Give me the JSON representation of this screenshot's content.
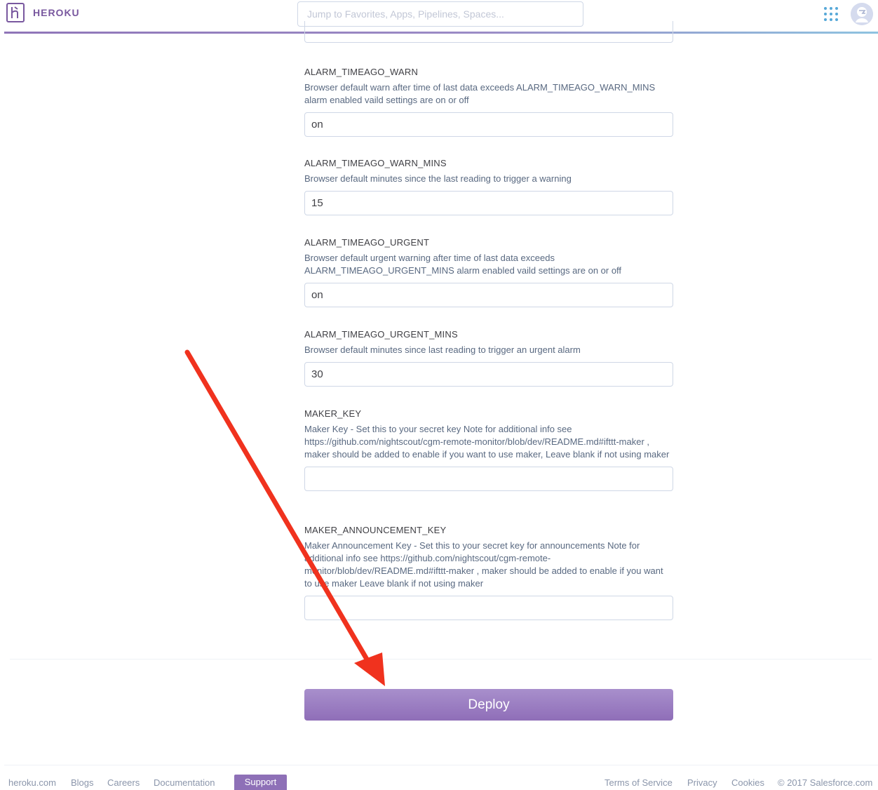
{
  "header": {
    "brand": "HEROKU",
    "search_placeholder": "Jump to Favorites, Apps, Pipelines, Spaces...",
    "apps_icon": "grid-dots-icon",
    "avatar_icon": "user-avatar-icon",
    "accent_color": "#79589f"
  },
  "fields": [
    {
      "key": "ALARM_TIMEAGO_WARN",
      "description": "Browser default warn after time of last data exceeds ALARM_TIMEAGO_WARN_MINS alarm enabled vaild settings are on or off",
      "value": "on"
    },
    {
      "key": "ALARM_TIMEAGO_WARN_MINS",
      "description": "Browser default minutes since the last reading to trigger a warning",
      "value": "15"
    },
    {
      "key": "ALARM_TIMEAGO_URGENT",
      "description": "Browser default urgent warning after time of last data exceeds ALARM_TIMEAGO_URGENT_MINS alarm enabled vaild settings are on or off",
      "value": "on"
    },
    {
      "key": "ALARM_TIMEAGO_URGENT_MINS",
      "description": "Browser default minutes since last reading to trigger an urgent alarm",
      "value": "30"
    },
    {
      "key": "MAKER_KEY",
      "description": "Maker Key - Set this to your secret key Note for additional info see https://github.com/nightscout/cgm-remote-monitor/blob/dev/README.md#ifttt-maker , maker should be added to enable if you want to use maker, Leave blank if not using maker",
      "value": ""
    },
    {
      "key": "MAKER_ANNOUNCEMENT_KEY",
      "description": "Maker Announcement Key - Set this to your secret key for announcements Note for additional info see https://github.com/nightscout/cgm-remote-monitor/blob/dev/README.md#ifttt-maker , maker should be added to enable if you want to use maker Leave blank if not using maker",
      "value": ""
    }
  ],
  "deploy": {
    "label": "Deploy",
    "color": "#9a7ec2"
  },
  "annotation": {
    "arrow_color": "#f0321e"
  },
  "footer": {
    "links_left": [
      "heroku.com",
      "Blogs",
      "Careers",
      "Documentation"
    ],
    "support_label": "Support",
    "links_right": [
      "Terms of Service",
      "Privacy",
      "Cookies"
    ],
    "copyright": "© 2017 Salesforce.com"
  }
}
